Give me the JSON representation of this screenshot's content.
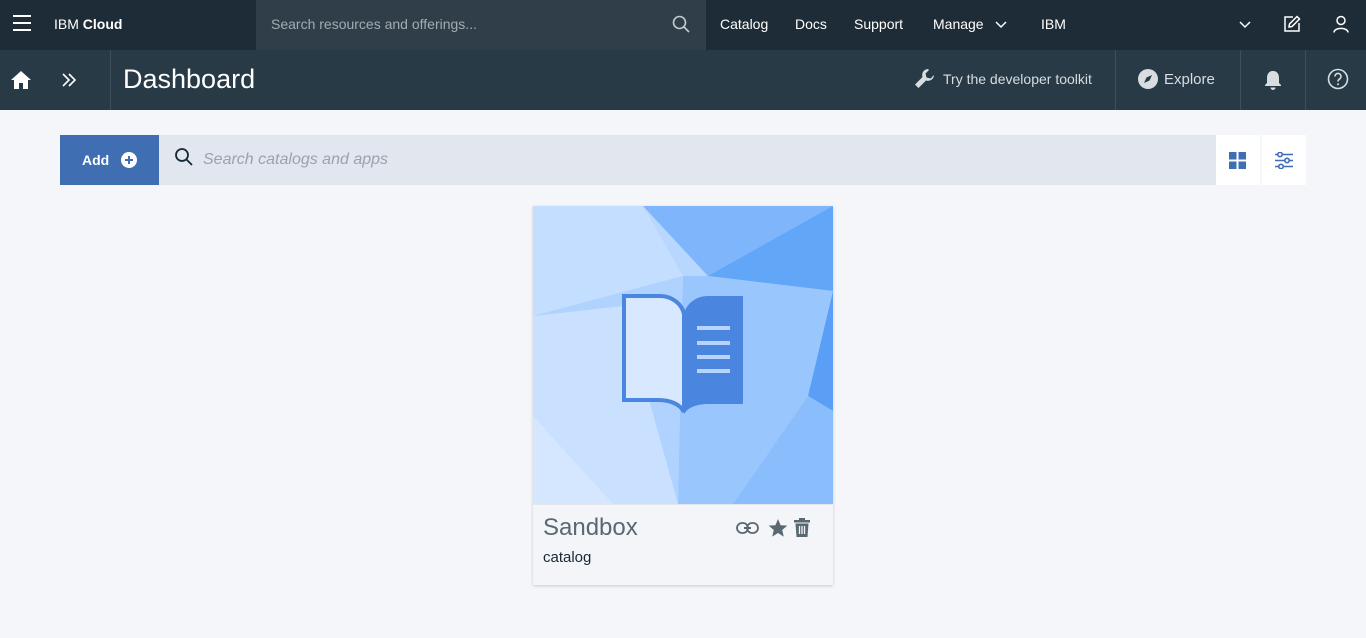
{
  "topbar": {
    "brand_prefix": "IBM",
    "brand_name": "Cloud",
    "search_placeholder": "Search resources and offerings...",
    "nav": {
      "catalog": "Catalog",
      "docs": "Docs",
      "support": "Support",
      "manage": "Manage",
      "account": "IBM"
    }
  },
  "subbar": {
    "title": "Dashboard",
    "toolkit_label": "Try the developer toolkit",
    "explore_label": "Explore"
  },
  "toolbar": {
    "add_label": "Add",
    "search_placeholder": "Search catalogs and apps"
  },
  "cards": [
    {
      "title": "Sandbox",
      "subtitle": "catalog"
    }
  ],
  "colors": {
    "topbar": "#1d2c36",
    "subbar": "#273a45",
    "accent": "#3f6eb3",
    "background": "#f5f6fa"
  }
}
